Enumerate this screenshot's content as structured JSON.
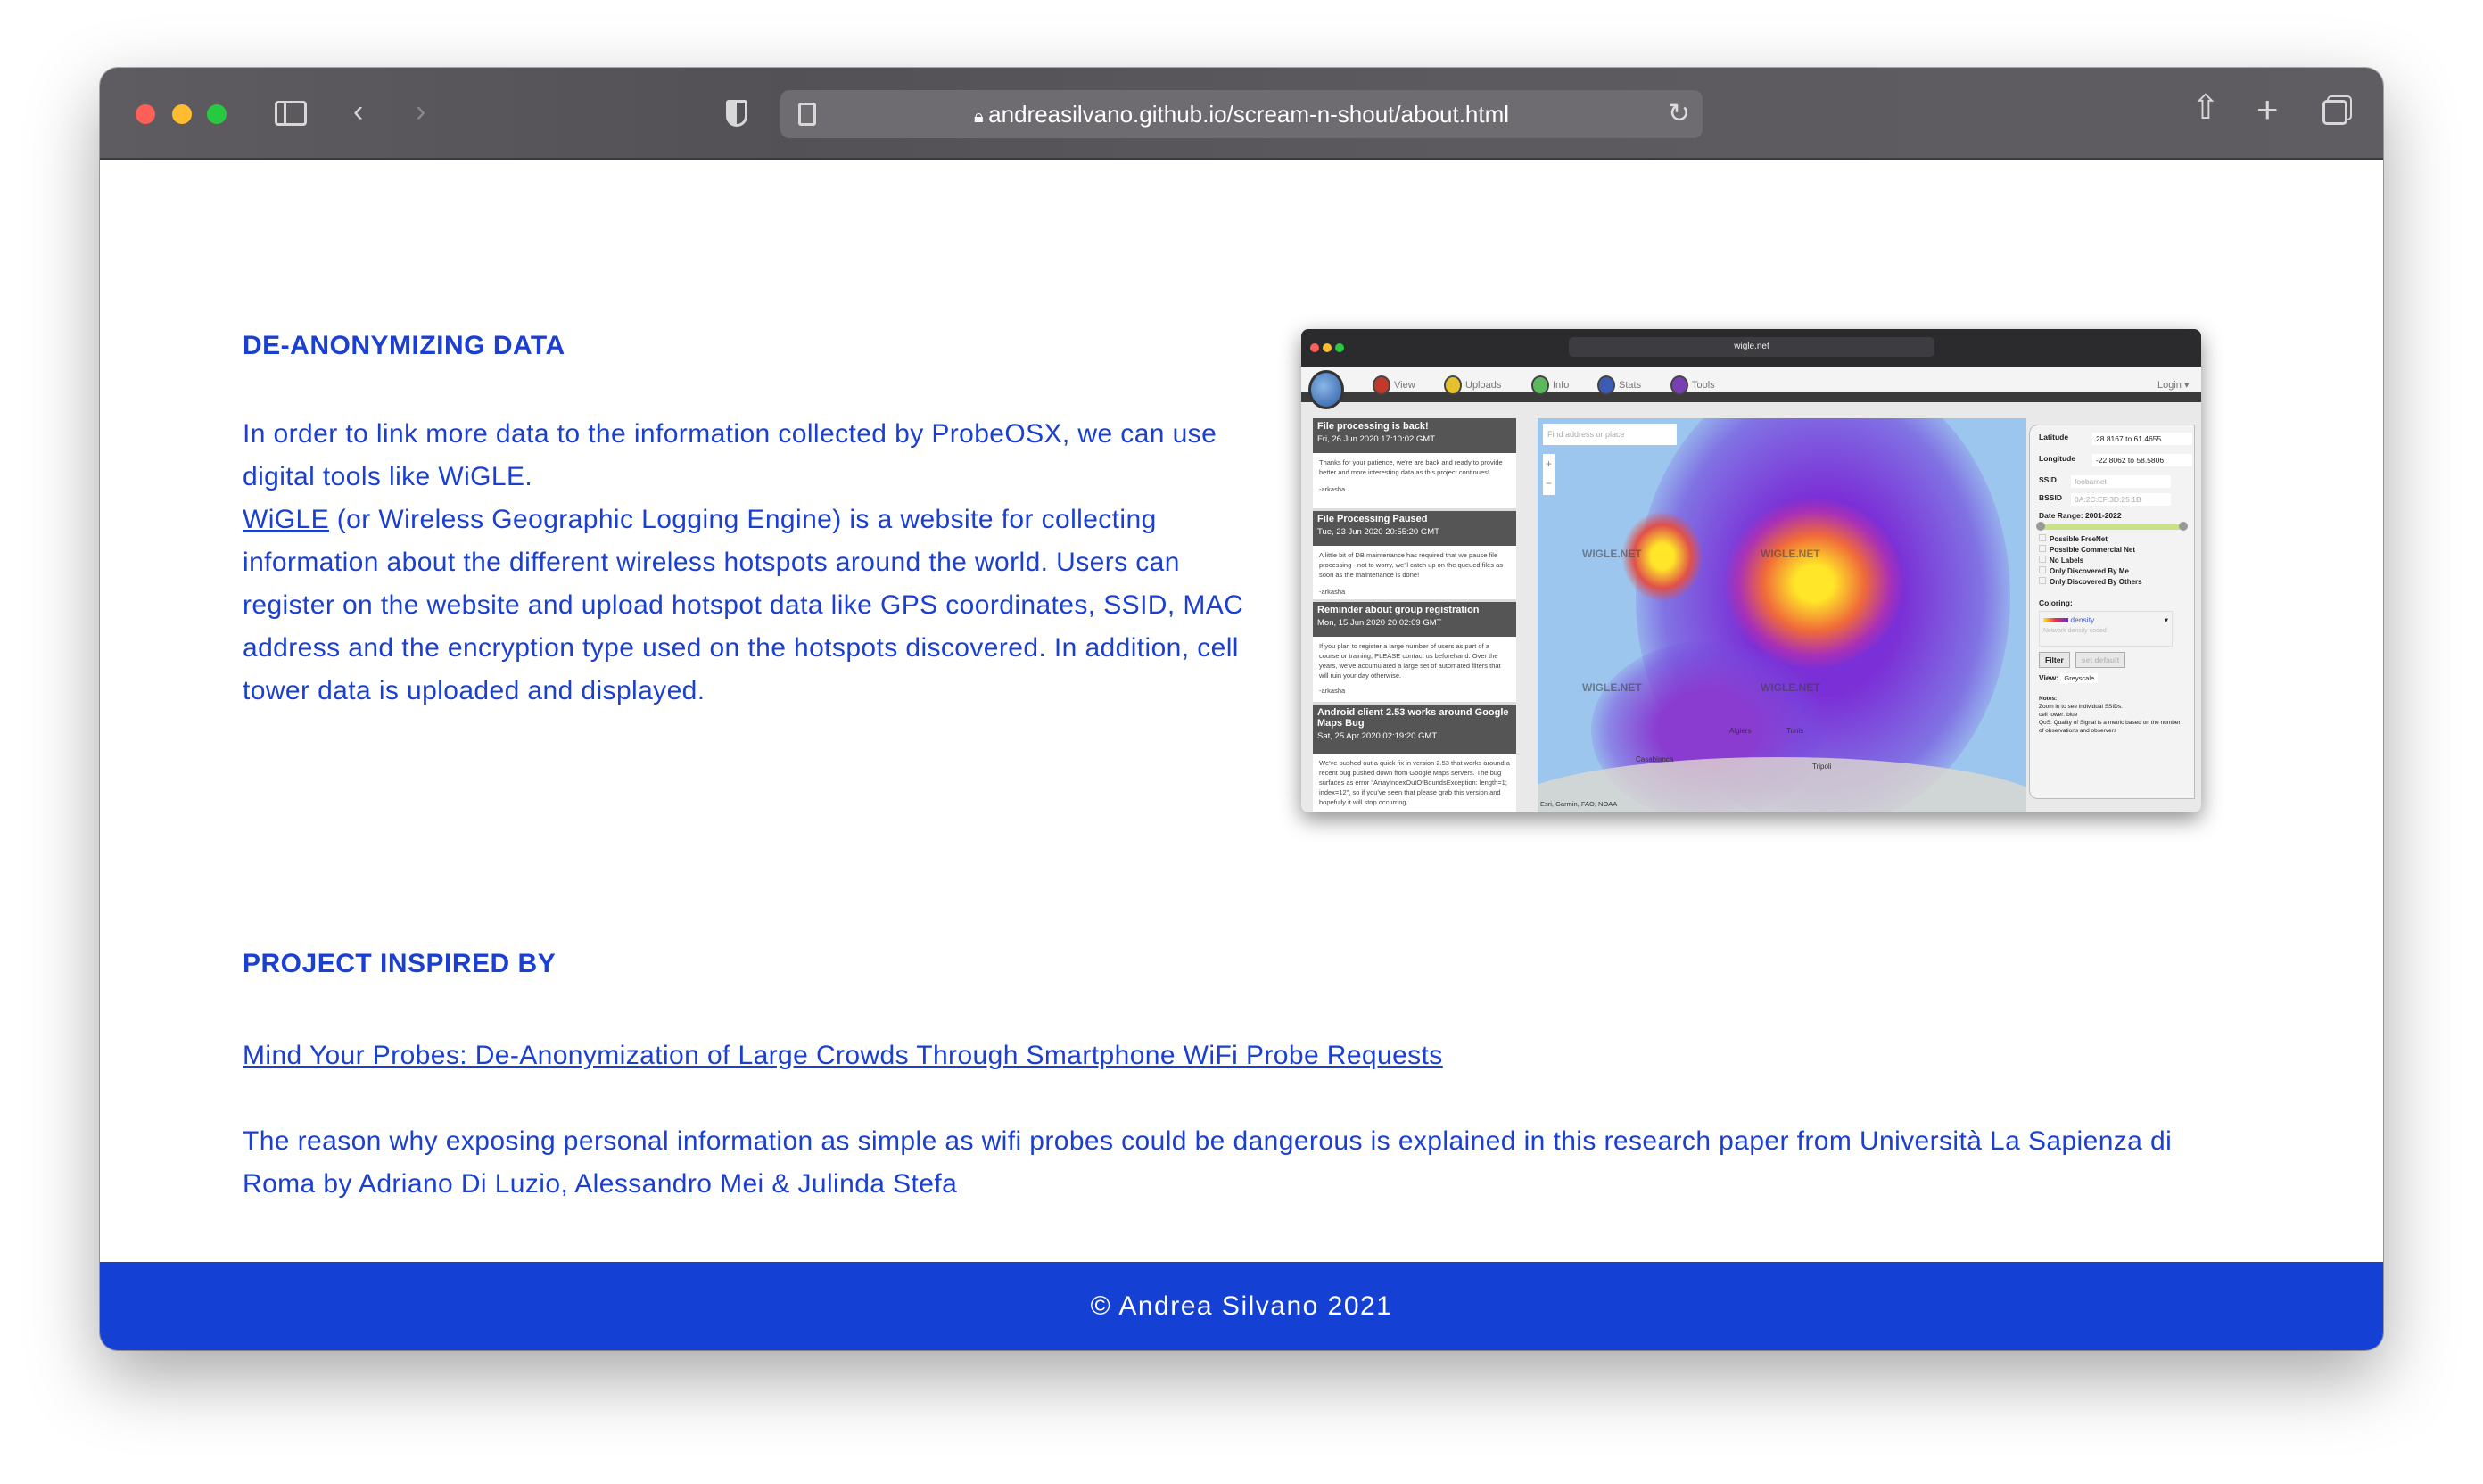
{
  "browser": {
    "url": "andreasilvano.github.io/scream-n-shout/about.html",
    "traffic_lights": [
      "#fe5f57",
      "#febc2e",
      "#28c840"
    ]
  },
  "section1": {
    "heading": "DE-ANONYMIZING DATA",
    "intro": "In order to link more data to the information collected by ProbeOSX, we can use digital tools like WiGLE.",
    "link": "WiGLE",
    "body": " (or Wireless Geographic Logging Engine) is a website for collecting information about the different wireless hotspots around the world. Users can register on the website and upload hotspot data like GPS coordinates, SSID, MAC address and the encryption type used on the hotspots discovered. In addition, cell tower data is uploaded and displayed."
  },
  "embedded": {
    "url": "wigle.net",
    "nav": [
      "View",
      "Uploads",
      "Info",
      "Stats",
      "Tools"
    ],
    "nav_colors": [
      "#c0392b",
      "#e6c12e",
      "#5cb85c",
      "#3b5bb5",
      "#7a3fb5"
    ],
    "login": "Login ▾",
    "news": [
      {
        "title": "File processing is back!",
        "date": "Fri, 26 Jun 2020 17:10:02 GMT",
        "body": "Thanks for your patience, we're are back and ready to provide better and more interesting data as this project continues!",
        "author": "-arkasha"
      },
      {
        "title": "File Processing Paused",
        "date": "Tue, 23 Jun 2020 20:55:20 GMT",
        "body": "A little bit of DB maintenance has required that we pause file processing - not to worry, we'll catch up on the queued files as soon as the maintenance is done!",
        "author": "-arkasha"
      },
      {
        "title": "Reminder about group registration",
        "date": "Mon, 15 Jun 2020 20:02:09 GMT",
        "body": "If you plan to register a large number of users as part of a course or training, PLEASE contact us beforehand. Over the years, we've accumulated a large set of automated filters that will ruin your day otherwise.",
        "author": "-arkasha"
      },
      {
        "title": "Android client 2.53 works around Google Maps Bug",
        "date": "Sat, 25 Apr 2020 02:19:20 GMT",
        "body": "We've pushed out a quick fix in version 2.53 that works around a recent bug pushed down from Google Maps servers. The bug surfaces as error \"ArrayIndexOutOfBoundsException: length=1; index=12\", so if you've seen that please grab this version and hopefully it will stop occurring.",
        "author": ""
      }
    ],
    "map": {
      "search_placeholder": "Find address or place",
      "zoom_in": "+",
      "zoom_out": "−",
      "watermark": "WIGLE.NET",
      "cities": [
        "Algiers",
        "Tunis",
        "Casablanca",
        "Tripoli"
      ],
      "attribution": "Esri, Garmin, FAO, NOAA"
    },
    "panel": {
      "latitude_label": "Latitude",
      "latitude": "28.8167 to 61.4655",
      "longitude_label": "Longitude",
      "longitude": "-22.8062 to 58.5806",
      "ssid_label": "SSID",
      "ssid_placeholder": "foobarnet",
      "bssid_label": "BSSID",
      "bssid_placeholder": "0A:2C:EF:3D:25:1B",
      "date_range": "Date Range: 2001-2022",
      "checkboxes": [
        "Possible FreeNet",
        "Possible Commercial Net",
        "No Labels",
        "Only Discovered By Me",
        "Only Discovered By Others"
      ],
      "coloring_label": "Coloring:",
      "coloring_value": "density",
      "coloring_desc": "Network density coded",
      "filter": "Filter",
      "set_default": "set default",
      "view_label": "View:",
      "view_value": "Greyscale",
      "notes_title": "Notes:",
      "notes": [
        "Zoom in to see individual SSIDs.",
        "cell tower: blue",
        "QoS: Quality of Signal is a metric based on the number of observations and observers"
      ]
    }
  },
  "section2": {
    "heading": "PROJECT INSPIRED BY",
    "link": "Mind Your Probes: De-Anonymization of Large Crowds Through Smartphone WiFi Probe Requests",
    "body": "The reason why exposing personal information as simple as wifi probes could be dangerous is explained in this research paper from Università La Sapienza di Roma by Adriano Di Luzio, Alessandro Mei & Julinda Stefa"
  },
  "footer": {
    "text": "© Andrea Silvano 2021"
  },
  "colors": {
    "text": "#1a3fd1",
    "footer_bg": "#1440d4"
  }
}
